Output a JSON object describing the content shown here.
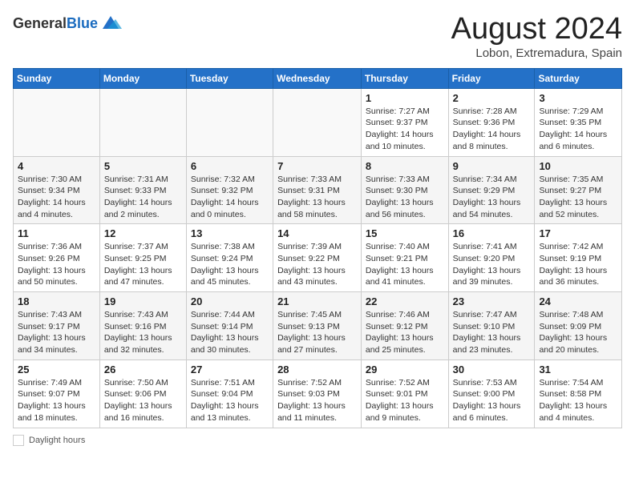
{
  "header": {
    "logo_general": "General",
    "logo_blue": "Blue",
    "month_title": "August 2024",
    "location": "Lobon, Extremadura, Spain"
  },
  "weekdays": [
    "Sunday",
    "Monday",
    "Tuesday",
    "Wednesday",
    "Thursday",
    "Friday",
    "Saturday"
  ],
  "weeks": [
    [
      {
        "day": "",
        "info": ""
      },
      {
        "day": "",
        "info": ""
      },
      {
        "day": "",
        "info": ""
      },
      {
        "day": "",
        "info": ""
      },
      {
        "day": "1",
        "info": "Sunrise: 7:27 AM\nSunset: 9:37 PM\nDaylight: 14 hours and 10 minutes."
      },
      {
        "day": "2",
        "info": "Sunrise: 7:28 AM\nSunset: 9:36 PM\nDaylight: 14 hours and 8 minutes."
      },
      {
        "day": "3",
        "info": "Sunrise: 7:29 AM\nSunset: 9:35 PM\nDaylight: 14 hours and 6 minutes."
      }
    ],
    [
      {
        "day": "4",
        "info": "Sunrise: 7:30 AM\nSunset: 9:34 PM\nDaylight: 14 hours and 4 minutes."
      },
      {
        "day": "5",
        "info": "Sunrise: 7:31 AM\nSunset: 9:33 PM\nDaylight: 14 hours and 2 minutes."
      },
      {
        "day": "6",
        "info": "Sunrise: 7:32 AM\nSunset: 9:32 PM\nDaylight: 14 hours and 0 minutes."
      },
      {
        "day": "7",
        "info": "Sunrise: 7:33 AM\nSunset: 9:31 PM\nDaylight: 13 hours and 58 minutes."
      },
      {
        "day": "8",
        "info": "Sunrise: 7:33 AM\nSunset: 9:30 PM\nDaylight: 13 hours and 56 minutes."
      },
      {
        "day": "9",
        "info": "Sunrise: 7:34 AM\nSunset: 9:29 PM\nDaylight: 13 hours and 54 minutes."
      },
      {
        "day": "10",
        "info": "Sunrise: 7:35 AM\nSunset: 9:27 PM\nDaylight: 13 hours and 52 minutes."
      }
    ],
    [
      {
        "day": "11",
        "info": "Sunrise: 7:36 AM\nSunset: 9:26 PM\nDaylight: 13 hours and 50 minutes."
      },
      {
        "day": "12",
        "info": "Sunrise: 7:37 AM\nSunset: 9:25 PM\nDaylight: 13 hours and 47 minutes."
      },
      {
        "day": "13",
        "info": "Sunrise: 7:38 AM\nSunset: 9:24 PM\nDaylight: 13 hours and 45 minutes."
      },
      {
        "day": "14",
        "info": "Sunrise: 7:39 AM\nSunset: 9:22 PM\nDaylight: 13 hours and 43 minutes."
      },
      {
        "day": "15",
        "info": "Sunrise: 7:40 AM\nSunset: 9:21 PM\nDaylight: 13 hours and 41 minutes."
      },
      {
        "day": "16",
        "info": "Sunrise: 7:41 AM\nSunset: 9:20 PM\nDaylight: 13 hours and 39 minutes."
      },
      {
        "day": "17",
        "info": "Sunrise: 7:42 AM\nSunset: 9:19 PM\nDaylight: 13 hours and 36 minutes."
      }
    ],
    [
      {
        "day": "18",
        "info": "Sunrise: 7:43 AM\nSunset: 9:17 PM\nDaylight: 13 hours and 34 minutes."
      },
      {
        "day": "19",
        "info": "Sunrise: 7:43 AM\nSunset: 9:16 PM\nDaylight: 13 hours and 32 minutes."
      },
      {
        "day": "20",
        "info": "Sunrise: 7:44 AM\nSunset: 9:14 PM\nDaylight: 13 hours and 30 minutes."
      },
      {
        "day": "21",
        "info": "Sunrise: 7:45 AM\nSunset: 9:13 PM\nDaylight: 13 hours and 27 minutes."
      },
      {
        "day": "22",
        "info": "Sunrise: 7:46 AM\nSunset: 9:12 PM\nDaylight: 13 hours and 25 minutes."
      },
      {
        "day": "23",
        "info": "Sunrise: 7:47 AM\nSunset: 9:10 PM\nDaylight: 13 hours and 23 minutes."
      },
      {
        "day": "24",
        "info": "Sunrise: 7:48 AM\nSunset: 9:09 PM\nDaylight: 13 hours and 20 minutes."
      }
    ],
    [
      {
        "day": "25",
        "info": "Sunrise: 7:49 AM\nSunset: 9:07 PM\nDaylight: 13 hours and 18 minutes."
      },
      {
        "day": "26",
        "info": "Sunrise: 7:50 AM\nSunset: 9:06 PM\nDaylight: 13 hours and 16 minutes."
      },
      {
        "day": "27",
        "info": "Sunrise: 7:51 AM\nSunset: 9:04 PM\nDaylight: 13 hours and 13 minutes."
      },
      {
        "day": "28",
        "info": "Sunrise: 7:52 AM\nSunset: 9:03 PM\nDaylight: 13 hours and 11 minutes."
      },
      {
        "day": "29",
        "info": "Sunrise: 7:52 AM\nSunset: 9:01 PM\nDaylight: 13 hours and 9 minutes."
      },
      {
        "day": "30",
        "info": "Sunrise: 7:53 AM\nSunset: 9:00 PM\nDaylight: 13 hours and 6 minutes."
      },
      {
        "day": "31",
        "info": "Sunrise: 7:54 AM\nSunset: 8:58 PM\nDaylight: 13 hours and 4 minutes."
      }
    ]
  ],
  "footer": {
    "legend_label": "Daylight hours"
  }
}
